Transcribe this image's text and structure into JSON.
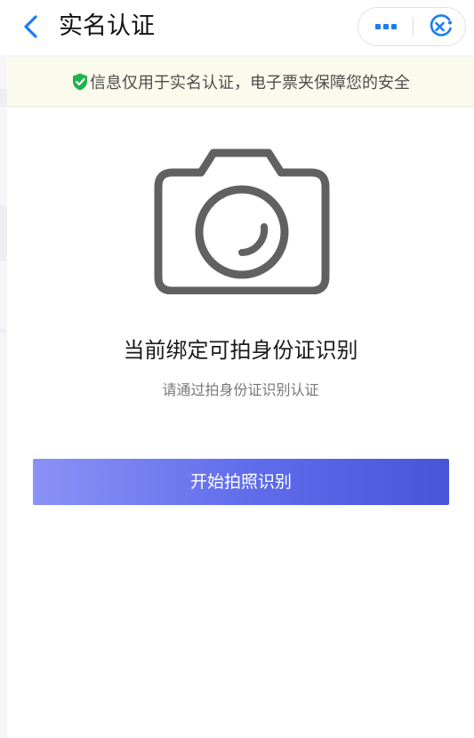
{
  "header": {
    "title": "实名认证",
    "back_icon": "chevron-left-icon",
    "more_icon": "more-dots-icon",
    "close_icon": "mini-program-close-icon",
    "accent_color": "#1a7ef0"
  },
  "notice": {
    "icon": "shield-check-icon",
    "icon_color": "#22b24c",
    "text": "信息仅用于实名认证，电子票夹保障您的安全",
    "background": "#fafbed"
  },
  "main": {
    "illustration": "camera-icon",
    "title": "当前绑定可拍身份证识别",
    "subtitle": "请通过拍身份证识别认证"
  },
  "action": {
    "start_label": "开始拍照识别",
    "gradient_start": "#8a92f6",
    "gradient_end": "#4955d8"
  }
}
